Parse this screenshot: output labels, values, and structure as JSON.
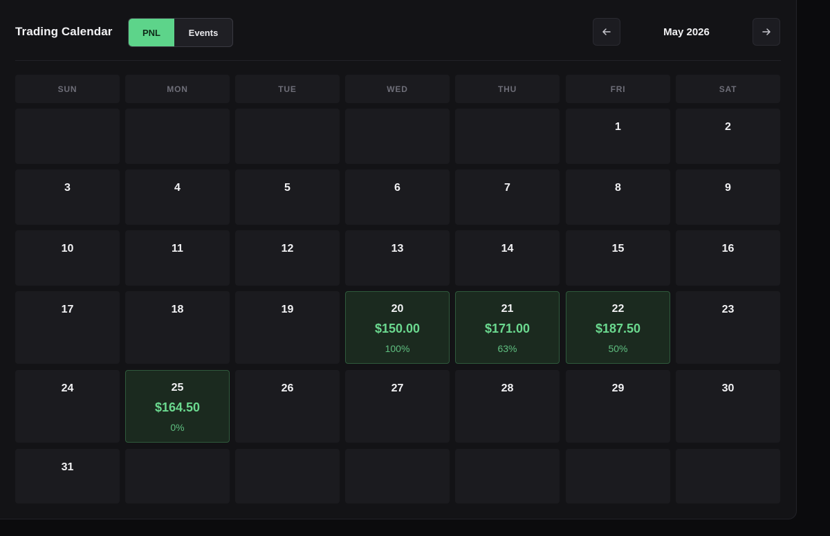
{
  "header": {
    "title": "Trading Calendar",
    "toggle": {
      "pnl_label": "PNL",
      "events_label": "Events",
      "selected": "PNL"
    },
    "month_label": "May 2026",
    "prev_icon": "arrow-left-icon",
    "next_icon": "arrow-right-icon"
  },
  "colors": {
    "accent": "#5dd48a",
    "profit_text": "#6bd98f",
    "active_cell_bg": "#1b2a1f"
  },
  "weekdays": [
    "SUN",
    "MON",
    "TUE",
    "WED",
    "THU",
    "FRI",
    "SAT"
  ],
  "weeks": [
    [
      {
        "day": ""
      },
      {
        "day": ""
      },
      {
        "day": ""
      },
      {
        "day": ""
      },
      {
        "day": ""
      },
      {
        "day": "1"
      },
      {
        "day": "2"
      }
    ],
    [
      {
        "day": "3"
      },
      {
        "day": "4"
      },
      {
        "day": "5"
      },
      {
        "day": "6"
      },
      {
        "day": "7"
      },
      {
        "day": "8"
      },
      {
        "day": "9"
      }
    ],
    [
      {
        "day": "10"
      },
      {
        "day": "11"
      },
      {
        "day": "12"
      },
      {
        "day": "13"
      },
      {
        "day": "14"
      },
      {
        "day": "15"
      },
      {
        "day": "16"
      }
    ],
    [
      {
        "day": "17"
      },
      {
        "day": "18"
      },
      {
        "day": "19"
      },
      {
        "day": "20",
        "pnl": "$150.00",
        "pct": "100%"
      },
      {
        "day": "21",
        "pnl": "$171.00",
        "pct": "63%"
      },
      {
        "day": "22",
        "pnl": "$187.50",
        "pct": "50%"
      },
      {
        "day": "23"
      }
    ],
    [
      {
        "day": "24"
      },
      {
        "day": "25",
        "pnl": "$164.50",
        "pct": "0%"
      },
      {
        "day": "26"
      },
      {
        "day": "27"
      },
      {
        "day": "28"
      },
      {
        "day": "29"
      },
      {
        "day": "30"
      }
    ],
    [
      {
        "day": "31"
      },
      {
        "day": ""
      },
      {
        "day": ""
      },
      {
        "day": ""
      },
      {
        "day": ""
      },
      {
        "day": ""
      },
      {
        "day": ""
      }
    ]
  ]
}
